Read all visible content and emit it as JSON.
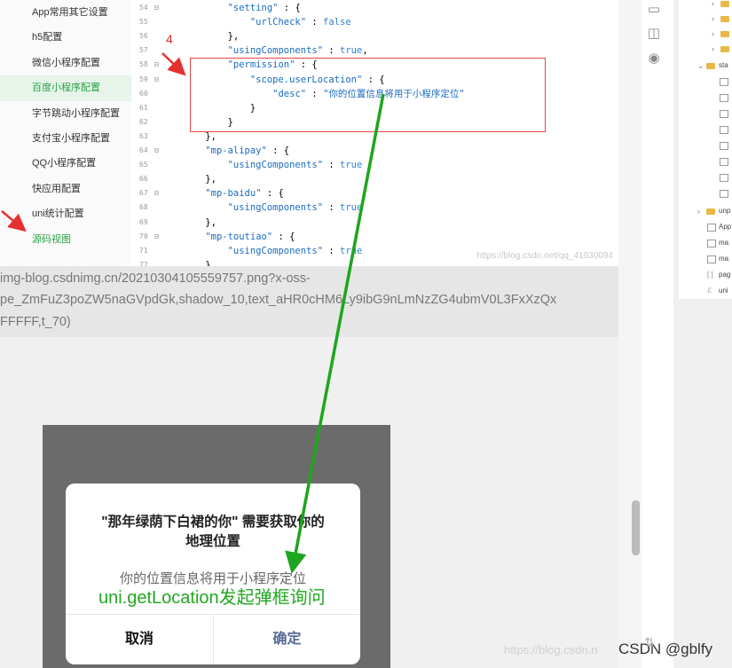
{
  "sidebar": {
    "items": [
      {
        "label": "App常用其它设置"
      },
      {
        "label": "h5配置"
      },
      {
        "label": "微信小程序配置"
      },
      {
        "label": "百度小程序配置"
      },
      {
        "label": "字节跳动小程序配置"
      },
      {
        "label": "支付宝小程序配置"
      },
      {
        "label": "QQ小程序配置"
      },
      {
        "label": "快应用配置"
      },
      {
        "label": "uni统计配置"
      },
      {
        "label": "源码视图"
      }
    ]
  },
  "editor": {
    "step_number": "4",
    "watermark": "https://blog.csdn.net/qq_41930094",
    "lines": [
      {
        "num": "54",
        "fold": "⊟",
        "code": "        \"setting\" : {"
      },
      {
        "num": "55",
        "fold": "",
        "code": "            \"urlCheck\" : false"
      },
      {
        "num": "56",
        "fold": "",
        "code": "        },"
      },
      {
        "num": "57",
        "fold": "",
        "code": "        \"usingComponents\" : true,"
      },
      {
        "num": "58",
        "fold": "⊟",
        "code": "        \"permission\" : {"
      },
      {
        "num": "59",
        "fold": "⊟",
        "code": "            \"scope.userLocation\" : {"
      },
      {
        "num": "60",
        "fold": "",
        "code": "                \"desc\" : \"你的位置信息将用于小程序定位\""
      },
      {
        "num": "61",
        "fold": "",
        "code": "            }"
      },
      {
        "num": "62",
        "fold": "",
        "code": "        }"
      },
      {
        "num": "63",
        "fold": "",
        "code": "    },"
      },
      {
        "num": "64",
        "fold": "⊟",
        "code": "    \"mp-alipay\" : {"
      },
      {
        "num": "65",
        "fold": "",
        "code": "        \"usingComponents\" : true"
      },
      {
        "num": "66",
        "fold": "",
        "code": "    },"
      },
      {
        "num": "67",
        "fold": "⊟",
        "code": "    \"mp-baidu\" : {"
      },
      {
        "num": "68",
        "fold": "",
        "code": "        \"usingComponents\" : true"
      },
      {
        "num": "69",
        "fold": "",
        "code": "    },"
      },
      {
        "num": "70",
        "fold": "⊟",
        "code": "    \"mp-toutiao\" : {"
      },
      {
        "num": "71",
        "fold": "",
        "code": "        \"usingComponents\" : true"
      },
      {
        "num": "72",
        "fold": "",
        "code": "    },"
      }
    ]
  },
  "broken_image": {
    "line1": "img-blog.csdnimg.cn/20210304105559757.png?x-oss-",
    "line2": "pe_ZmFuZ3poZW5naGVpdGk,shadow_10,text_aHR0cHM6Ly9ibG9nLmNzZG4ubmV0L3FxXzQx",
    "line3": "FFFFF,t_70)"
  },
  "file_tree": {
    "rows": [
      "sta",
      "unp",
      "App",
      "ma",
      "ma",
      "pag",
      "uni"
    ]
  },
  "dialog": {
    "title_line1": "\"那年绿荫下白裙的你\" 需要获取你的",
    "title_line2": "地理位置",
    "description": "你的位置信息将用于小程序定位",
    "cancel_label": "取消",
    "confirm_label": "确定"
  },
  "annotation": {
    "text": "uni.getLocation发起弹框询问"
  },
  "watermarks": {
    "faint": "https://blog.csdn.n",
    "credit": "CSDN @gblfy"
  },
  "colors": {
    "accent_green": "#2ba245",
    "highlight_red": "#e64545",
    "arrow_green": "#1fa51f",
    "confirm_blue": "#576b95"
  }
}
